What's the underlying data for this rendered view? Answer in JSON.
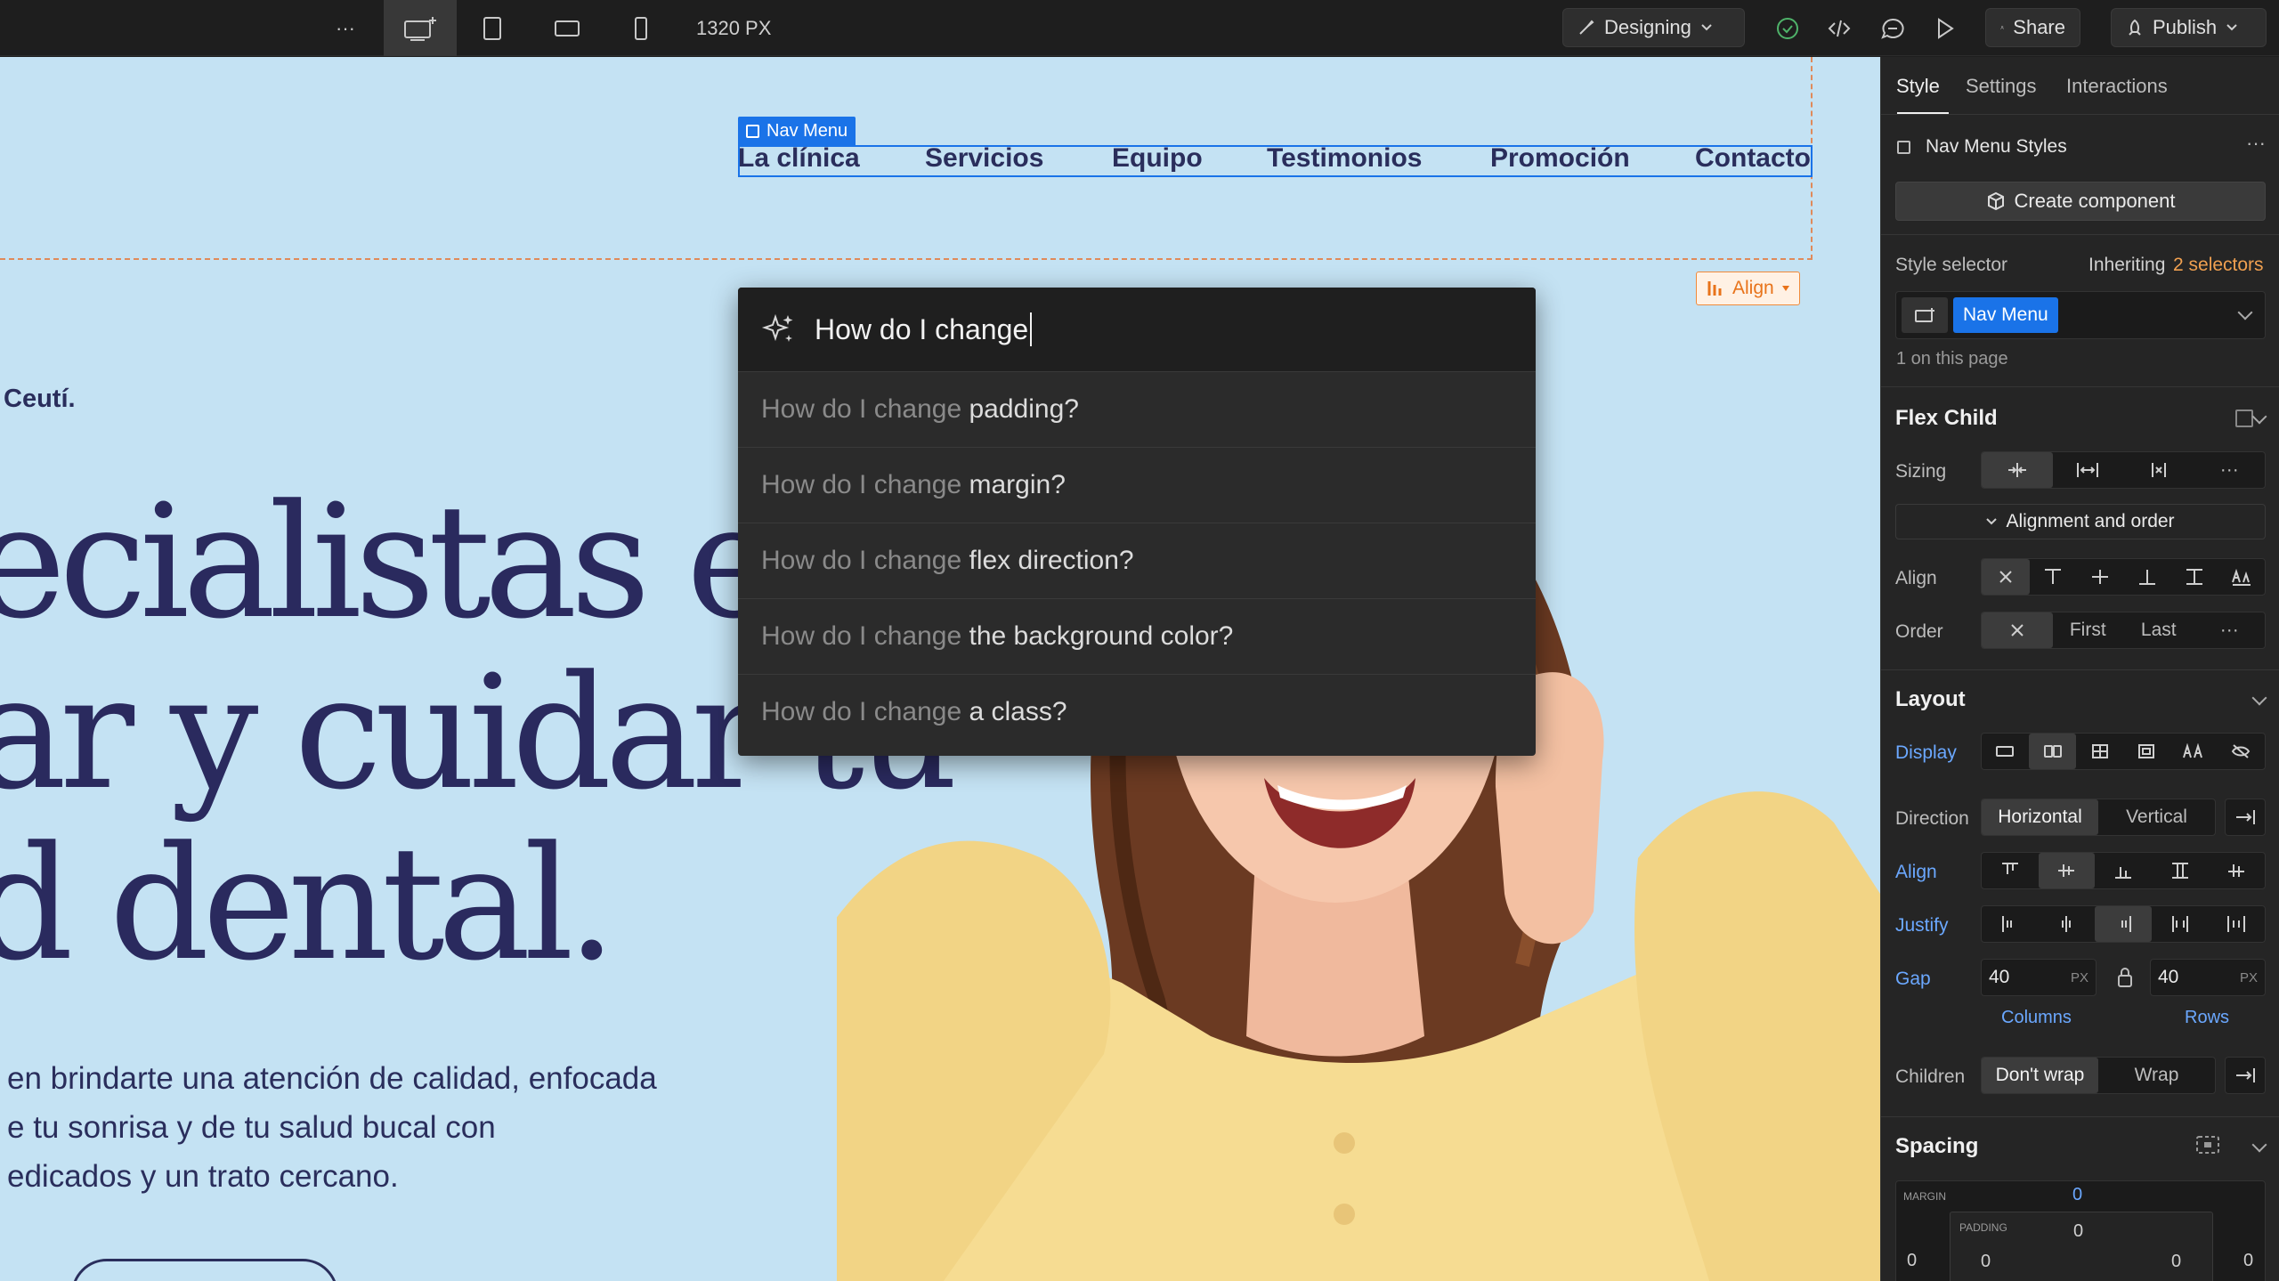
{
  "topbar": {
    "more_label": "···",
    "breakpoint_width": "1320 PX",
    "mode_label": "Designing",
    "share_label": "Share",
    "publish_label": "Publish"
  },
  "canvas": {
    "nav_badge": "Nav Menu",
    "nav_links": [
      "La clínica",
      "Servicios",
      "Equipo",
      "Testimonios",
      "Promoción",
      "Contacto"
    ],
    "hero_small": "Ceutí.",
    "hero_title_lines": [
      "ecialistas en",
      "ar y cuidar tu",
      "d dental."
    ],
    "hero_body_lines": [
      " en brindarte una atención de calidad, enfocada",
      "e tu sonrisa y de tu salud bucal con",
      "edicados y un trato cercano."
    ],
    "align_chip": "Align"
  },
  "ai_popup": {
    "query": "How do I change",
    "suggestions": [
      {
        "prefix": "How do I change",
        "suffix": " padding?"
      },
      {
        "prefix": "How do I change",
        "suffix": " margin?"
      },
      {
        "prefix": "How do I change",
        "suffix": " flex direction?"
      },
      {
        "prefix": "How do I change",
        "suffix": " the background color?"
      },
      {
        "prefix": "How do I change",
        "suffix": " a class?"
      }
    ]
  },
  "panel": {
    "tabs": [
      "Style",
      "Settings",
      "Interactions"
    ],
    "styles_header": "Nav Menu Styles",
    "create_component": "Create component",
    "style_selector_label": "Style selector",
    "inheriting_text": "Inheriting",
    "inheriting_count": "2 selectors",
    "selector_chip": "Nav Menu",
    "on_page": "1 on this page",
    "flex_child": {
      "title": "Flex Child",
      "sizing_label": "Sizing",
      "alignment_toggle": "Alignment and order",
      "align_label": "Align",
      "order_label": "Order",
      "order_options": [
        "First",
        "Last"
      ]
    },
    "layout": {
      "title": "Layout",
      "display_label": "Display",
      "direction_label": "Direction",
      "direction_options": [
        "Horizontal",
        "Vertical"
      ],
      "align_label": "Align",
      "justify_label": "Justify",
      "gap_label": "Gap",
      "gap_columns": "40",
      "gap_rows": "40",
      "gap_unit": "PX",
      "columns_label": "Columns",
      "rows_label": "Rows",
      "children_label": "Children",
      "children_options": [
        "Don't wrap",
        "Wrap"
      ]
    },
    "spacing": {
      "title": "Spacing",
      "margin_label": "MARGIN",
      "padding_label": "PADDING",
      "margin_top": "0",
      "padding_top": "0",
      "margin_left": "0",
      "padding_left": "0",
      "padding_right": "0",
      "margin_right": "0"
    }
  }
}
